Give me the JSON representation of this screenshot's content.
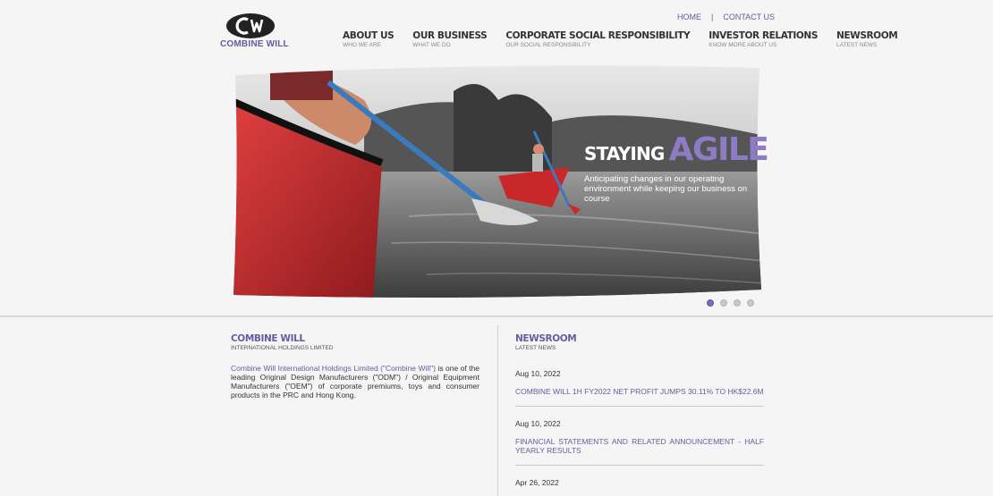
{
  "brand": {
    "name": "COMBINE WILL",
    "monogram": "CW"
  },
  "toplinks": {
    "home": "HOME",
    "separator": "|",
    "contact": "CONTACT US"
  },
  "nav": [
    {
      "label": "ABOUT US",
      "sub": "WHO WE ARE"
    },
    {
      "label": "OUR BUSINESS",
      "sub": "WHAT WE DO"
    },
    {
      "label": "CORPORATE SOCIAL RESPONSIBILITY",
      "sub": "OUR SOCIAL RESPONSIBILITY"
    },
    {
      "label": "INVESTOR RELATIONS",
      "sub": "KNOW MORE ABOUT US"
    },
    {
      "label": "NEWSROOM",
      "sub": "LATEST NEWS"
    }
  ],
  "banner": {
    "slogan_a": "STAYING",
    "slogan_b": "AGILE",
    "slogan_sub": "Anticipating changes in our operating environment while keeping our business on course",
    "slides": 4,
    "active_slide": 1
  },
  "about": {
    "title": "COMBINE WILL",
    "subtitle": "INTERNATIONAL HOLDINGS LIMITED",
    "intro_highlight": "Combine Will International Holdings Limited (\"Combine Will\")",
    "intro_rest": " is one of the leading Original Design Manufacturers (\"ODM\") / Original Equipment Manufacturers (\"OEM\") of corporate premiums, toys and consumer products in the PRC and Hong Kong."
  },
  "newsroom": {
    "title": "NEWSROOM",
    "subtitle": "LATEST NEWS",
    "items": [
      {
        "date": "Aug 10, 2022",
        "title": "COMBINE WILL 1H FY2022 NET PROFIT JUMPS 30.11% TO HK$22.6M"
      },
      {
        "date": "Aug 10, 2022",
        "title": "FINANCIAL STATEMENTS AND RELATED ANNOUNCEMENT - HALF YEARLY RESULTS"
      },
      {
        "date": "Apr 26, 2022",
        "title": ""
      }
    ]
  },
  "colors": {
    "accent": "#6a5a9e",
    "accent_light": "#8e7bc4",
    "canoe_red": "#c8282a",
    "paddle_blue": "#3a7bbf"
  }
}
